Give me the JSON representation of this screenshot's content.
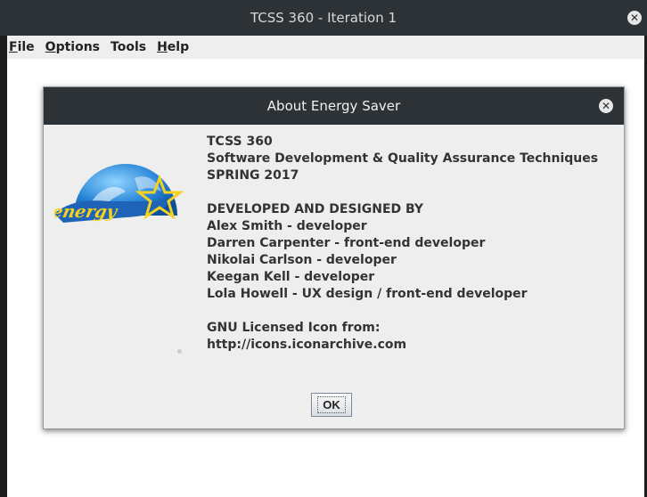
{
  "window": {
    "title": "TCSS 360 - Iteration 1",
    "close_icon": "close-icon"
  },
  "menubar": {
    "items": [
      "File",
      "Options",
      "Tools",
      "Help"
    ]
  },
  "dialog": {
    "title": "About Energy Saver",
    "logo_text": "energy",
    "lines": [
      "TCSS 360",
      "Software Development & Quality Assurance Techniques",
      "SPRING 2017",
      "",
      "DEVELOPED AND DESIGNED BY",
      "Alex Smith - developer",
      "Darren Carpenter - front-end developer",
      "Nikolai Carlson - developer",
      "Keegan Kell - developer",
      "Lola Howell - UX design / front-end developer",
      "",
      "GNU Licensed Icon from:",
      "http://icons.iconarchive.com"
    ],
    "ok_label": "OK"
  },
  "colors": {
    "titlebar": "#2d3236",
    "energy_blue": "#1e63b5",
    "star_yellow": "#f6d21c"
  }
}
